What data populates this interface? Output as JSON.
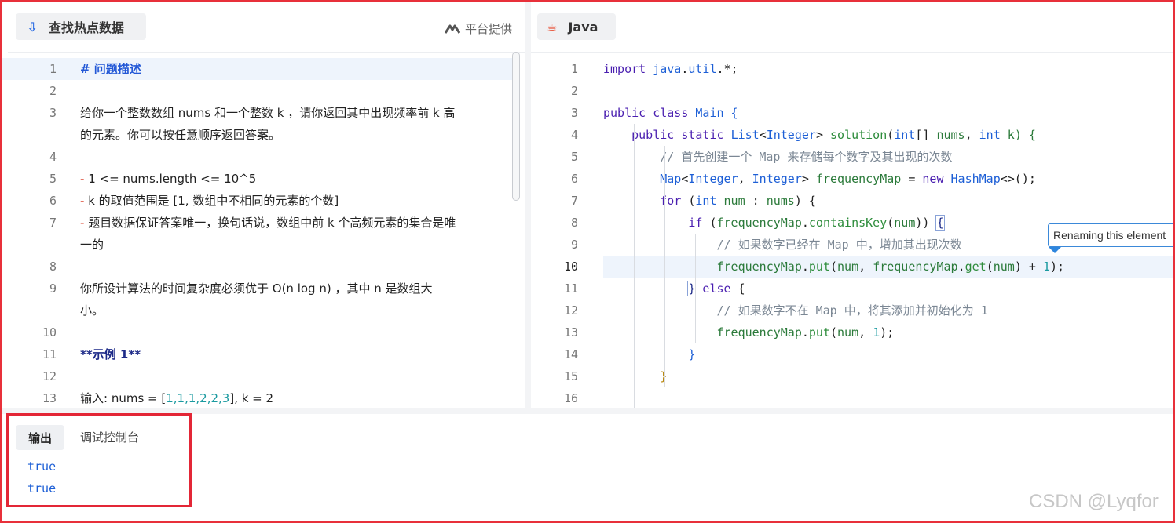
{
  "left_panel": {
    "tab_title": "查找热点数据",
    "provider_label": "平台提供",
    "lines": [
      {
        "n": "1",
        "parts": [
          {
            "t": "# 问题描述",
            "c": "md-head"
          }
        ]
      },
      {
        "n": "2",
        "parts": []
      },
      {
        "n": "3",
        "parts": [
          {
            "t": "给你一个整数数组 nums 和一个整数 k ，请你返回其中出现频率前 k 高",
            "c": ""
          }
        ]
      },
      {
        "n": "",
        "parts": [
          {
            "t": "的元素。你可以按任意顺序返回答案。",
            "c": ""
          }
        ]
      },
      {
        "n": "4",
        "parts": []
      },
      {
        "n": "5",
        "parts": [
          {
            "t": "-",
            "c": "md-dash"
          },
          {
            "t": " 1 <= nums.length <= 10^5",
            "c": ""
          }
        ]
      },
      {
        "n": "6",
        "parts": [
          {
            "t": "-",
            "c": "md-dash"
          },
          {
            "t": " k 的取值范围是 [1, 数组中不相同的元素的个数]",
            "c": ""
          }
        ]
      },
      {
        "n": "7",
        "parts": [
          {
            "t": "-",
            "c": "md-dash"
          },
          {
            "t": " 题目数据保证答案唯一，换句话说，数组中前 k 个高频元素的集合是唯",
            "c": ""
          }
        ]
      },
      {
        "n": "",
        "parts": [
          {
            "t": "一的",
            "c": ""
          }
        ]
      },
      {
        "n": "8",
        "parts": []
      },
      {
        "n": "9",
        "parts": [
          {
            "t": "你所设计算法的时间复杂度必须优于 O(n log n) ，其中 n 是数组大",
            "c": ""
          }
        ]
      },
      {
        "n": "",
        "parts": [
          {
            "t": "小。",
            "c": ""
          }
        ]
      },
      {
        "n": "10",
        "parts": []
      },
      {
        "n": "11",
        "parts": [
          {
            "t": "**示例 1**",
            "c": "md-bold"
          }
        ]
      },
      {
        "n": "12",
        "parts": []
      },
      {
        "n": "13",
        "parts": [
          {
            "t": "输入: nums = [",
            "c": ""
          },
          {
            "t": "1,1,1,2,2,3",
            "c": "num"
          },
          {
            "t": "], k = 2",
            "c": ""
          }
        ]
      }
    ]
  },
  "editor": {
    "language": "Java",
    "tooltip": "Renaming this element",
    "active_line": "10",
    "lines": [
      {
        "n": "1",
        "parts": [
          {
            "t": "import ",
            "c": "kw"
          },
          {
            "t": "java",
            "c": "pkg"
          },
          {
            "t": ".",
            "c": ""
          },
          {
            "t": "util",
            "c": "pkg"
          },
          {
            "t": ".*;",
            "c": ""
          }
        ]
      },
      {
        "n": "2",
        "parts": []
      },
      {
        "n": "3",
        "parts": [
          {
            "t": "public class ",
            "c": "kw"
          },
          {
            "t": "Main",
            "c": "ty"
          },
          {
            "t": " {",
            "c": "ty"
          }
        ]
      },
      {
        "n": "4",
        "parts": [
          {
            "t": "    public static ",
            "c": "kw"
          },
          {
            "t": "List",
            "c": "ty"
          },
          {
            "t": "<",
            "c": ""
          },
          {
            "t": "Integer",
            "c": "ty"
          },
          {
            "t": "> ",
            "c": ""
          },
          {
            "t": "solution",
            "c": "fn"
          },
          {
            "t": "(",
            "c": ""
          },
          {
            "t": "int",
            "c": "ty"
          },
          {
            "t": "[] ",
            "c": ""
          },
          {
            "t": "nums",
            "c": "id"
          },
          {
            "t": ", ",
            "c": ""
          },
          {
            "t": "int",
            "c": "ty"
          },
          {
            "t": " k",
            "c": "id"
          },
          {
            "t": ") {",
            "c": "id"
          }
        ]
      },
      {
        "n": "5",
        "parts": [
          {
            "t": "        // 首先创建一个 Map 来存储每个数字及其出现的次数",
            "c": "cm"
          }
        ]
      },
      {
        "n": "6",
        "parts": [
          {
            "t": "        ",
            "c": ""
          },
          {
            "t": "Map",
            "c": "ty"
          },
          {
            "t": "<",
            "c": ""
          },
          {
            "t": "Integer",
            "c": "ty"
          },
          {
            "t": ", ",
            "c": ""
          },
          {
            "t": "Integer",
            "c": "ty"
          },
          {
            "t": "> ",
            "c": ""
          },
          {
            "t": "frequencyMap",
            "c": "id"
          },
          {
            "t": " = ",
            "c": ""
          },
          {
            "t": "new ",
            "c": "kw"
          },
          {
            "t": "HashMap",
            "c": "ty"
          },
          {
            "t": "<>();",
            "c": ""
          }
        ]
      },
      {
        "n": "7",
        "parts": [
          {
            "t": "        for ",
            "c": "kw"
          },
          {
            "t": "(",
            "c": ""
          },
          {
            "t": "int",
            "c": "ty"
          },
          {
            "t": " num",
            "c": "id"
          },
          {
            "t": " : ",
            "c": ""
          },
          {
            "t": "nums",
            "c": "id"
          },
          {
            "t": ") {",
            "c": ""
          }
        ]
      },
      {
        "n": "8",
        "parts": [
          {
            "t": "            if ",
            "c": "kw"
          },
          {
            "t": "(",
            "c": ""
          },
          {
            "t": "frequencyMap",
            "c": "id"
          },
          {
            "t": ".",
            "c": ""
          },
          {
            "t": "containsKey",
            "c": "fn"
          },
          {
            "t": "(",
            "c": ""
          },
          {
            "t": "num",
            "c": "id"
          },
          {
            "t": ")) ",
            "c": ""
          },
          {
            "t": "{",
            "c": "bm"
          }
        ]
      },
      {
        "n": "9",
        "parts": [
          {
            "t": "                // 如果数字已经在 Map 中，增加其出现次数",
            "c": "cm"
          }
        ]
      },
      {
        "n": "10",
        "parts": [
          {
            "t": "                ",
            "c": ""
          },
          {
            "t": "frequencyMap",
            "c": "id"
          },
          {
            "t": ".",
            "c": ""
          },
          {
            "t": "put",
            "c": "fn"
          },
          {
            "t": "(",
            "c": ""
          },
          {
            "t": "num",
            "c": "id"
          },
          {
            "t": ", ",
            "c": ""
          },
          {
            "t": "frequencyMap",
            "c": "id"
          },
          {
            "t": ".",
            "c": ""
          },
          {
            "t": "get",
            "c": "fn"
          },
          {
            "t": "(",
            "c": ""
          },
          {
            "t": "num",
            "c": "id"
          },
          {
            "t": ") + ",
            "c": ""
          },
          {
            "t": "1",
            "c": "nb"
          },
          {
            "t": ");",
            "c": ""
          }
        ]
      },
      {
        "n": "11",
        "parts": [
          {
            "t": "            ",
            "c": ""
          },
          {
            "t": "}",
            "c": "bm"
          },
          {
            "t": " else ",
            "c": "kw"
          },
          {
            "t": "{",
            "c": ""
          }
        ]
      },
      {
        "n": "12",
        "parts": [
          {
            "t": "                // 如果数字不在 Map 中，将其添加并初始化为 1",
            "c": "cm"
          }
        ]
      },
      {
        "n": "13",
        "parts": [
          {
            "t": "                ",
            "c": ""
          },
          {
            "t": "frequencyMap",
            "c": "id"
          },
          {
            "t": ".",
            "c": ""
          },
          {
            "t": "put",
            "c": "fn"
          },
          {
            "t": "(",
            "c": ""
          },
          {
            "t": "num",
            "c": "id"
          },
          {
            "t": ", ",
            "c": ""
          },
          {
            "t": "1",
            "c": "nb"
          },
          {
            "t": ");",
            "c": ""
          }
        ]
      },
      {
        "n": "14",
        "parts": [
          {
            "t": "            }",
            "c": "ty"
          }
        ]
      },
      {
        "n": "15",
        "parts": [
          {
            "t": "        }",
            "c": "br"
          }
        ]
      },
      {
        "n": "16",
        "parts": []
      }
    ]
  },
  "bottom": {
    "tabs": [
      "输出",
      "调试控制台"
    ],
    "output": [
      "true",
      "true"
    ]
  },
  "watermark": "CSDN @Lyqfor"
}
